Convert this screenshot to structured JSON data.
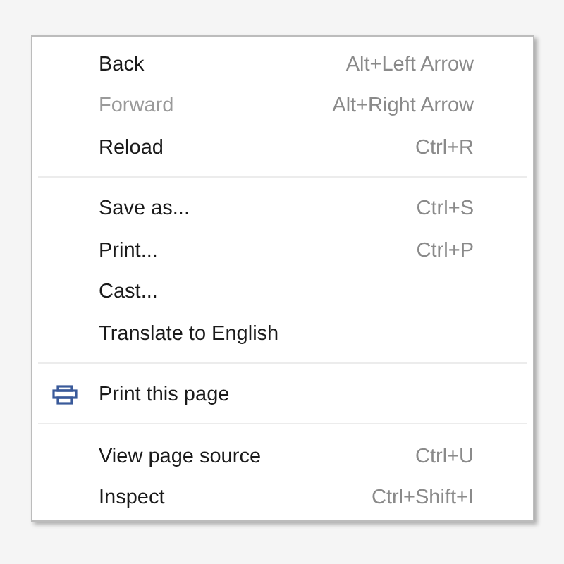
{
  "context_menu": {
    "sections": [
      {
        "items": [
          {
            "kind": "item",
            "label": "Back",
            "shortcut": "Alt+Left Arrow",
            "disabled": false
          },
          {
            "kind": "item",
            "label": "Forward",
            "shortcut": "Alt+Right Arrow",
            "disabled": true
          },
          {
            "kind": "item",
            "label": "Reload",
            "shortcut": "Ctrl+R",
            "disabled": false
          }
        ]
      },
      {
        "items": [
          {
            "kind": "item",
            "label": "Save as...",
            "shortcut": "Ctrl+S",
            "disabled": false
          },
          {
            "kind": "item",
            "label": "Print...",
            "shortcut": "Ctrl+P",
            "disabled": false
          },
          {
            "kind": "item",
            "label": "Cast...",
            "disabled": false
          },
          {
            "kind": "item",
            "label": "Translate to English",
            "disabled": false
          }
        ]
      },
      {
        "items": [
          {
            "kind": "icon-item",
            "label": "Print this page",
            "disabled": false
          }
        ]
      },
      {
        "items": [
          {
            "kind": "item",
            "label": "View page source",
            "shortcut": "Ctrl+U",
            "disabled": false
          },
          {
            "kind": "item",
            "label": "Inspect",
            "shortcut": "Ctrl+Shift+I",
            "disabled": false
          }
        ]
      }
    ]
  }
}
